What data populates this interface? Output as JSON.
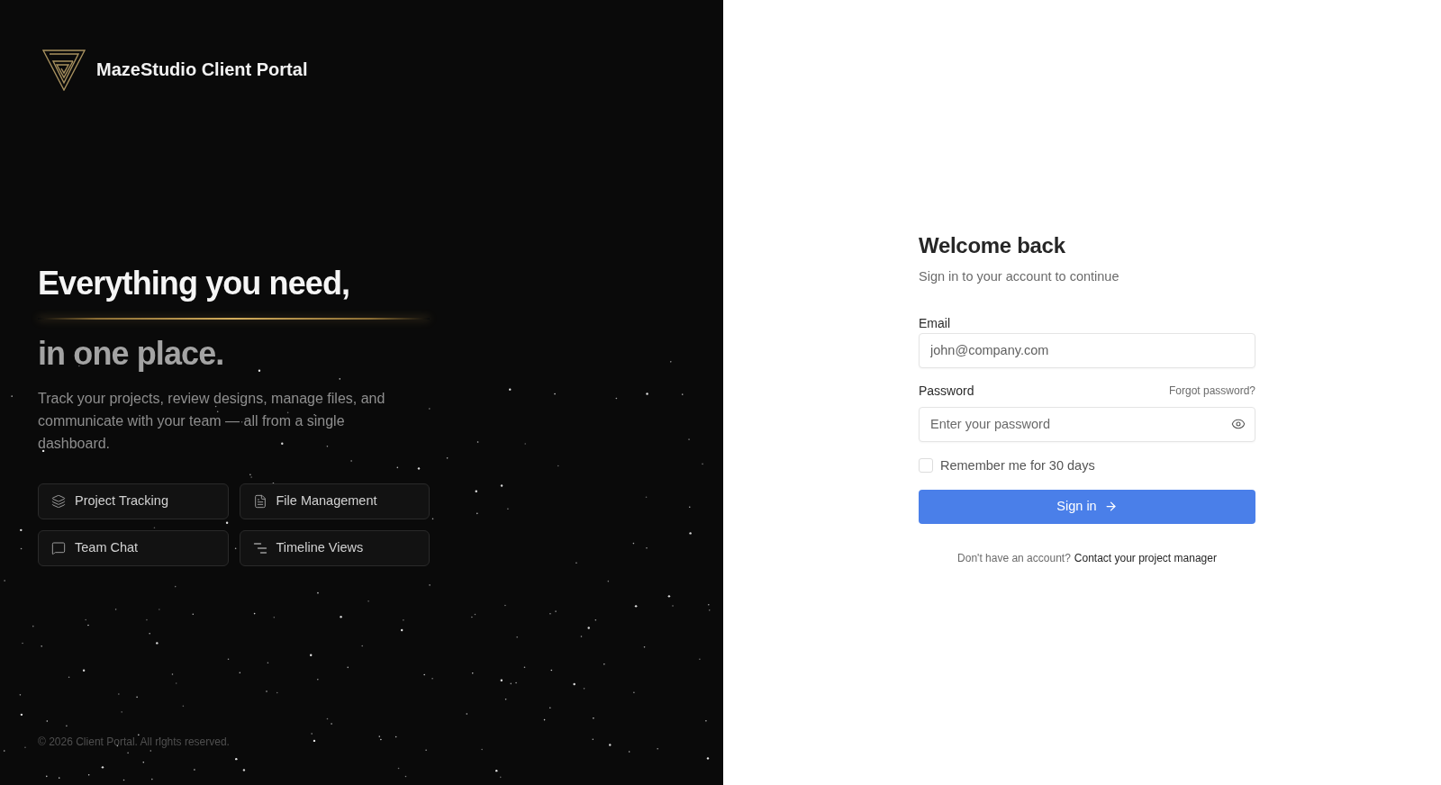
{
  "brand": {
    "name": "MazeStudio Client Portal"
  },
  "hero": {
    "headline_lines": [
      "Everything you need,",
      "in one place."
    ],
    "description": "Track your projects, review designs, manage files, and communicate with your team — all from a single dashboard.",
    "features": [
      {
        "label": "Project Tracking"
      },
      {
        "label": "File Management"
      },
      {
        "label": "Team Chat"
      },
      {
        "label": "Timeline Views"
      }
    ]
  },
  "footer": {
    "copyright": "© 2026 Client Portal. All rights reserved."
  },
  "login": {
    "title": "Welcome back",
    "subtitle": "Sign in to your account to continue",
    "fields": [
      {
        "kind": "email",
        "label": "Email",
        "placeholder": "john@company.com"
      },
      {
        "kind": "password",
        "label": "Password",
        "placeholder": "Enter your password",
        "link": "Forgot password?"
      }
    ],
    "remember": {
      "label": "Remember me for 30 days",
      "checked": false
    },
    "submit": {
      "label": "Sign in"
    },
    "signup_prompt": {
      "text": "Don't have an account?",
      "link": "Contact your project manager"
    }
  }
}
